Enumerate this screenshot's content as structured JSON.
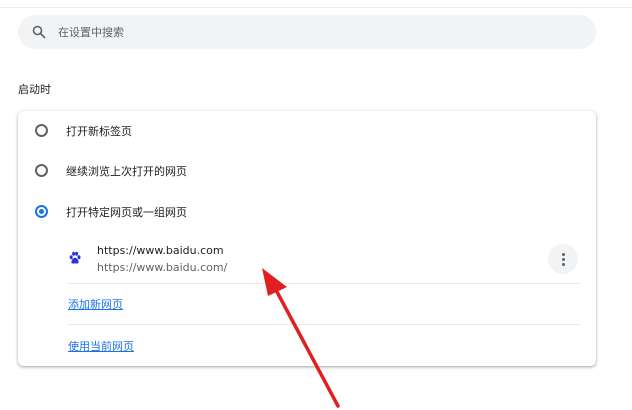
{
  "search": {
    "placeholder": "在设置中搜索"
  },
  "startup": {
    "title": "启动时",
    "options": [
      {
        "label": "打开新标签页",
        "checked": false
      },
      {
        "label": "继续浏览上次打开的网页",
        "checked": false
      },
      {
        "label": "打开特定网页或一组网页",
        "checked": true
      }
    ],
    "site": {
      "name": "https://www.baidu.com",
      "url": "https://www.baidu.com/",
      "icon": "baidu-paw-icon"
    },
    "add_page_link": "添加新网页",
    "use_current_link": "使用当前网页"
  },
  "colors": {
    "accent": "#1a73e8",
    "annotation_arrow": "#e02020",
    "site_icon": "#2932e1"
  }
}
